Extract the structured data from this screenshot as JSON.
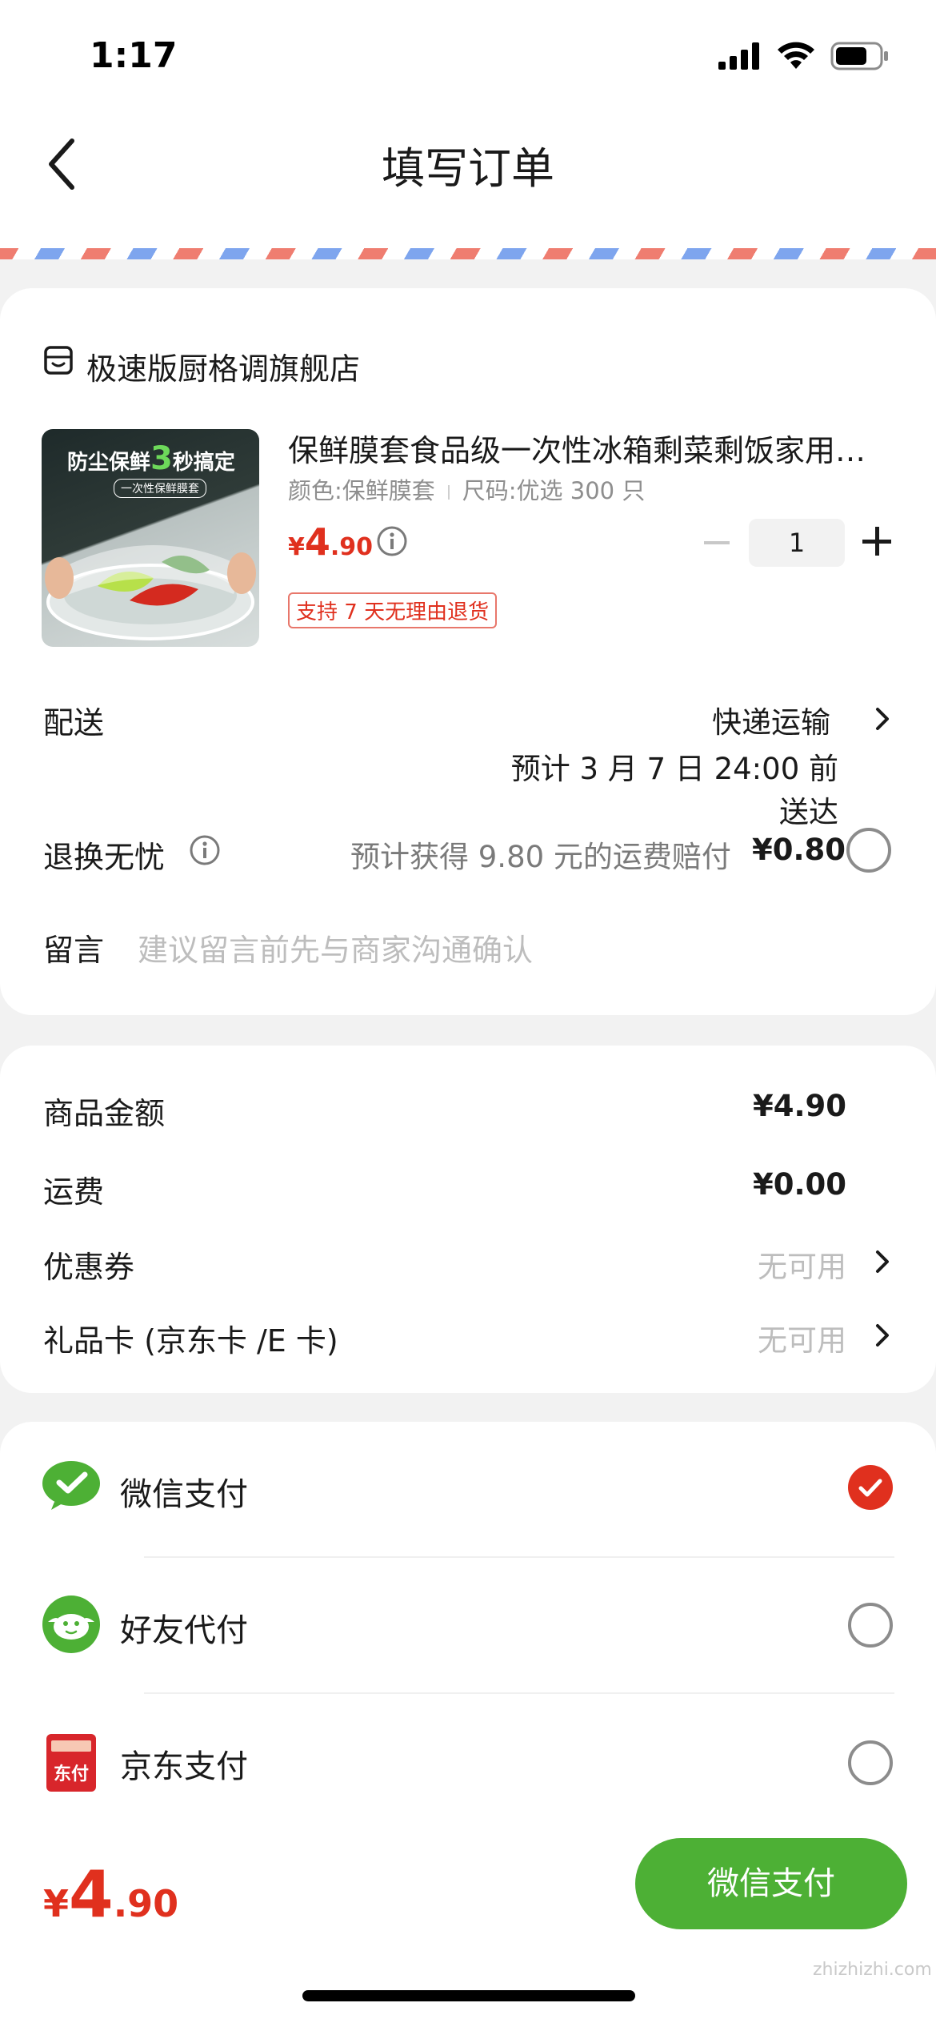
{
  "status_bar": {
    "time": "1:17"
  },
  "header": {
    "title": "填写订单"
  },
  "shop": {
    "name": "极速版厨格调旗舰店"
  },
  "product": {
    "image_headline_a": "防尘保鲜",
    "image_headline_num": "3",
    "image_headline_b": "秒搞定",
    "image_sub": "一次性保鲜膜套",
    "title": "保鲜膜套食品级一次性冰箱剩菜剩饭家用…",
    "spec_color": "颜色:保鲜膜套",
    "spec_size": "尺码:优选 300 只",
    "price_currency": "¥",
    "price_int": "4",
    "price_dec": ".90",
    "return_tag": "支持 7 天无理由退货",
    "quantity": "1"
  },
  "delivery": {
    "label": "配送",
    "method": "快递运输",
    "eta": "预计 3 月 7 日 24:00 前送达"
  },
  "return_worry_free": {
    "label": "退换无忧",
    "desc": "预计获得 9.80 元的运费赔付",
    "price": "¥0.80"
  },
  "message": {
    "label": "留言",
    "placeholder": "建议留言前先与商家沟通确认"
  },
  "summary": {
    "goods_amount_label": "商品金额",
    "goods_amount": "¥4.90",
    "shipping_label": "运费",
    "shipping": "¥0.00",
    "coupon_label": "优惠券",
    "coupon_value": "无可用",
    "giftcard_label": "礼品卡 (京东卡 /E 卡)",
    "giftcard_value": "无可用"
  },
  "payment_methods": [
    {
      "label": "微信支付",
      "selected": true
    },
    {
      "label": "好友代付",
      "selected": false
    },
    {
      "label": "京东支付",
      "selected": false
    }
  ],
  "jd_icon_text": "东付",
  "footer": {
    "total_currency": "¥",
    "total_int": "4",
    "total_dec": ".90",
    "pay_button": "微信支付"
  },
  "watermark": "zhizhizhi.com",
  "colors": {
    "accent_red": "#e0301e",
    "wechat_green": "#4db035"
  }
}
